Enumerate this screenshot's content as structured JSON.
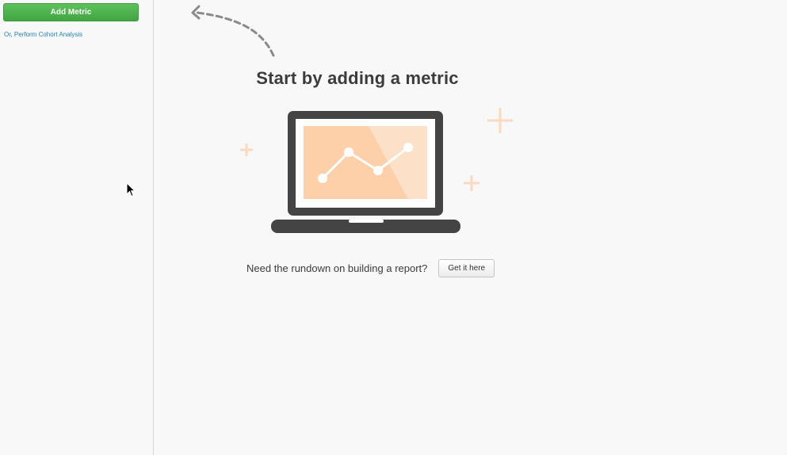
{
  "sidebar": {
    "add_metric_label": "Add Metric",
    "cohort_link_label": "Or, Perform Cohort Analysis"
  },
  "main": {
    "headline": "Start by adding a metric",
    "rundown_text": "Need the rundown on building a report?",
    "get_it_label": "Get it here"
  },
  "colors": {
    "accent_green": "#4bb34b",
    "link_blue": "#1f86c2",
    "laptop_gray": "#444444",
    "screen_peach": "#fdd0a9",
    "plus_peach": "#fbd9c0"
  },
  "icons": {
    "arrow": "dashed-curved-arrow-icon",
    "laptop": "laptop-chart-icon",
    "plus": "plus-icon",
    "cursor": "mouse-pointer-icon"
  }
}
